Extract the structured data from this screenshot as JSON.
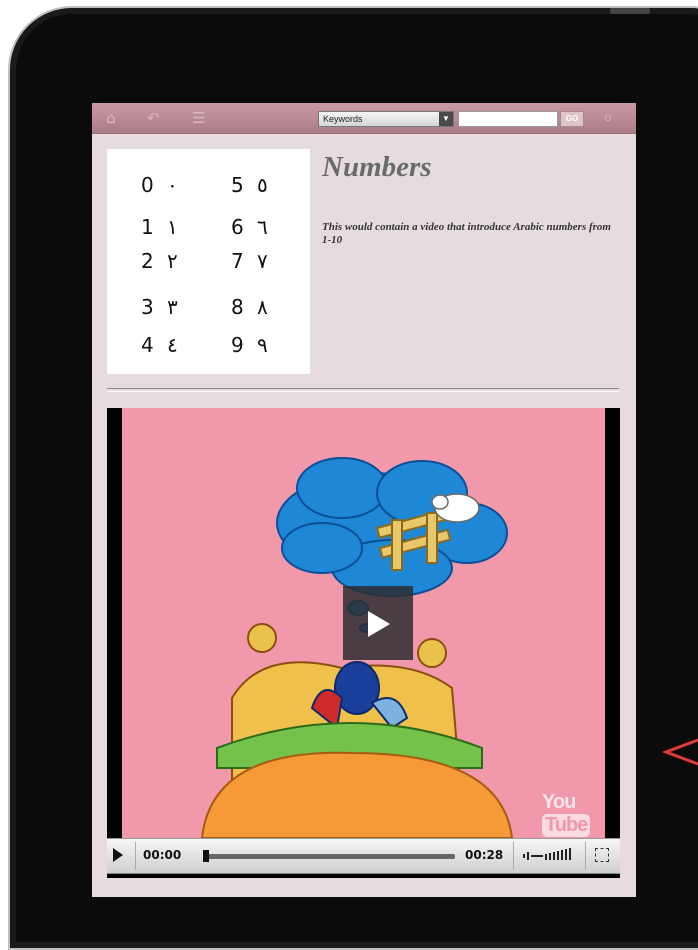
{
  "toolbar": {
    "home_icon": "home-icon",
    "back_icon": "back-icon",
    "menu_icon": "list-icon",
    "keyword_select": "Keywords",
    "search_value": "",
    "go_label": "GO",
    "help_icon": "help-icon"
  },
  "numbers": [
    {
      "latin": "0",
      "arabic": "٠"
    },
    {
      "latin": "1",
      "arabic": "١"
    },
    {
      "latin": "2",
      "arabic": "٢"
    },
    {
      "latin": "3",
      "arabic": "٣"
    },
    {
      "latin": "4",
      "arabic": "٤"
    },
    {
      "latin": "5",
      "arabic": "٥"
    },
    {
      "latin": "6",
      "arabic": "٦"
    },
    {
      "latin": "7",
      "arabic": "٧"
    },
    {
      "latin": "8",
      "arabic": "٨"
    },
    {
      "latin": "9",
      "arabic": "٩"
    }
  ],
  "content": {
    "title": "Numbers",
    "description": "This would contain a video that introduce Arabic numbers from 1-10"
  },
  "video": {
    "logo_you": "You",
    "logo_tube": "Tube",
    "current_time": "00:00",
    "duration": "00:28",
    "progress": 0
  },
  "colors": {
    "toolbar": "#b98892",
    "page_background": "#e6dcdf",
    "video_background": "#f198aa"
  }
}
